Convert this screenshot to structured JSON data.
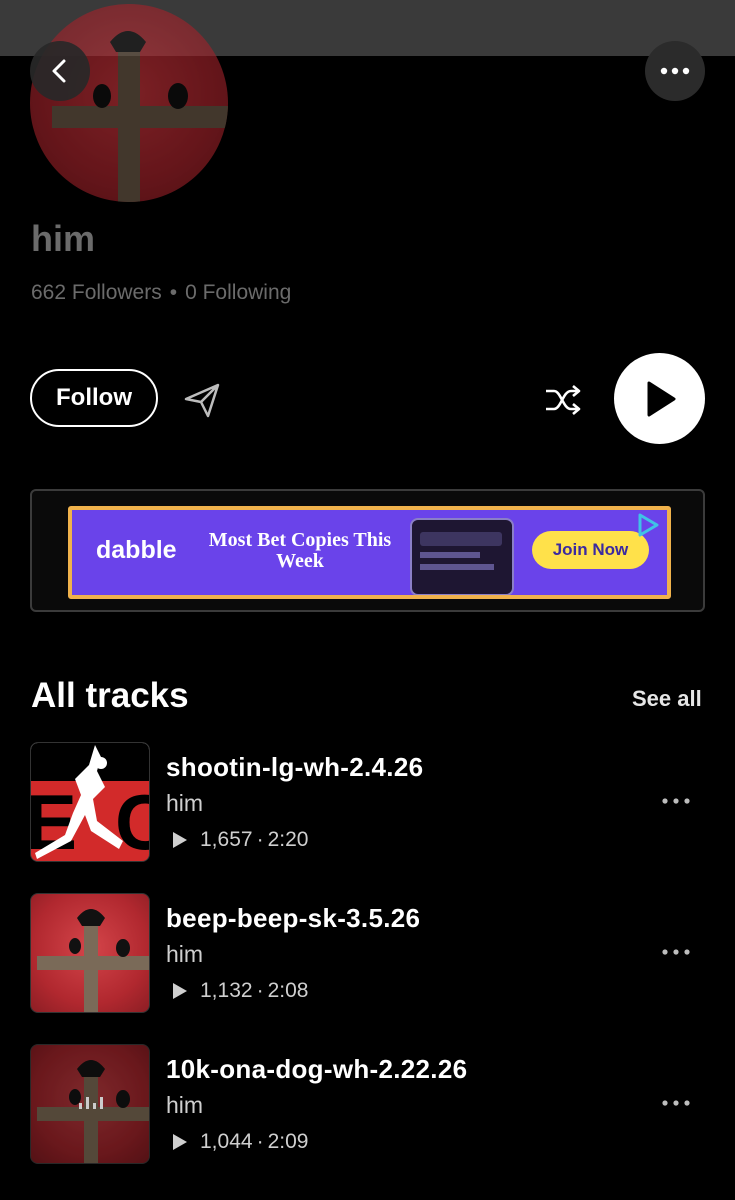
{
  "profile": {
    "name": "him",
    "followers_text": "662 Followers",
    "following_text": "0 Following",
    "separator": "•"
  },
  "actions": {
    "follow_label": "Follow"
  },
  "ad": {
    "brand": "dabble",
    "headline": "Most Bet Copies This Week",
    "cta_label": "Join Now",
    "colors": {
      "background": "#6a43ea",
      "border": "#f0b24c",
      "cta": "#ffe14a"
    }
  },
  "tracks_section": {
    "title": "All tracks",
    "see_all_label": "See all"
  },
  "tracks": [
    {
      "title": "shootin-lg-wh-2.4.26",
      "artist": "him",
      "plays": "1,657",
      "separator": "·",
      "duration": "2:20",
      "art": "epic-jumpman-art"
    },
    {
      "title": "beep-beep-sk-3.5.26",
      "artist": "him",
      "plays": "1,132",
      "separator": "·",
      "duration": "2:08",
      "art": "cross-crows-art"
    },
    {
      "title": "10k-ona-dog-wh-2.22.26",
      "artist": "him",
      "plays": "1,044",
      "separator": "·",
      "duration": "2:09",
      "art": "cross-crows-art-now-playing"
    }
  ],
  "icons": {
    "back": "chevron-left-icon",
    "more": "ellipsis-icon",
    "share": "paper-plane-icon",
    "shuffle": "shuffle-icon",
    "play": "play-icon",
    "now_playing": "equalizer-icon"
  }
}
